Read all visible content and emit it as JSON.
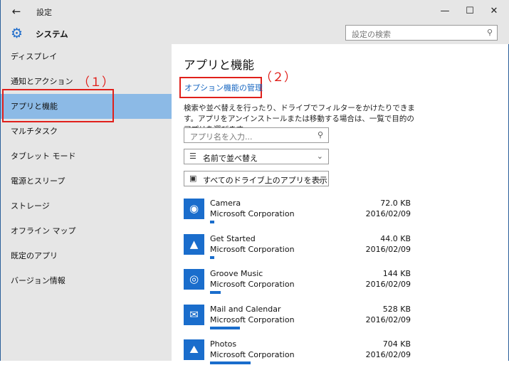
{
  "titlebar": {
    "back_icon": "back-arrow-icon",
    "title": "設定",
    "minimize": "—",
    "maximize": "☐",
    "close": "✕"
  },
  "header": {
    "icon": "gear-icon",
    "title": "システム",
    "search_placeholder": "設定の検索",
    "search_icon": "search-icon"
  },
  "sidebar": {
    "items": [
      {
        "label": "ディスプレイ",
        "selected": false
      },
      {
        "label": "通知とアクション",
        "selected": false
      },
      {
        "label": "アプリと機能",
        "selected": true
      },
      {
        "label": "マルチタスク",
        "selected": false
      },
      {
        "label": "タブレット モード",
        "selected": false
      },
      {
        "label": "電源とスリープ",
        "selected": false
      },
      {
        "label": "ストレージ",
        "selected": false
      },
      {
        "label": "オフライン マップ",
        "selected": false
      },
      {
        "label": "既定のアプリ",
        "selected": false
      },
      {
        "label": "バージョン情報",
        "selected": false
      }
    ]
  },
  "annotations": {
    "one": "（１）",
    "two": "（２）",
    "color": "#e0201b"
  },
  "main": {
    "title": "アプリと機能",
    "manage_link": "オプション機能の管理",
    "description": "検索や並べ替えを行ったり、ドライブでフィルターをかけたりできます。アプリをアンインストールまたは移動する場合は、一覧で目的のアプリを選びます。",
    "app_search_placeholder": "アプリ名を入力...",
    "sort_label": "名前で並べ替え",
    "filter_label": "すべてのドライブ上のアプリを表示",
    "accent_color": "#1a6dcc",
    "apps": [
      {
        "name": "Camera",
        "publisher": "Microsoft Corporation",
        "size": "72.0 KB",
        "date": "2016/02/09",
        "icon": "camera-icon",
        "usage": 0.03
      },
      {
        "name": "Get Started",
        "publisher": "Microsoft Corporation",
        "size": "44.0 KB",
        "date": "2016/02/09",
        "icon": "lightbulb-icon",
        "usage": 0.02
      },
      {
        "name": "Groove Music",
        "publisher": "Microsoft Corporation",
        "size": "144 KB",
        "date": "2016/02/09",
        "icon": "music-disc-icon",
        "usage": 0.07
      },
      {
        "name": "Mail and Calendar",
        "publisher": "Microsoft Corporation",
        "size": "528 KB",
        "date": "2016/02/09",
        "icon": "mail-icon",
        "usage": 0.2
      },
      {
        "name": "Photos",
        "publisher": "Microsoft Corporation",
        "size": "704 KB",
        "date": "2016/02/09",
        "icon": "photo-icon",
        "usage": 0.27
      }
    ]
  }
}
